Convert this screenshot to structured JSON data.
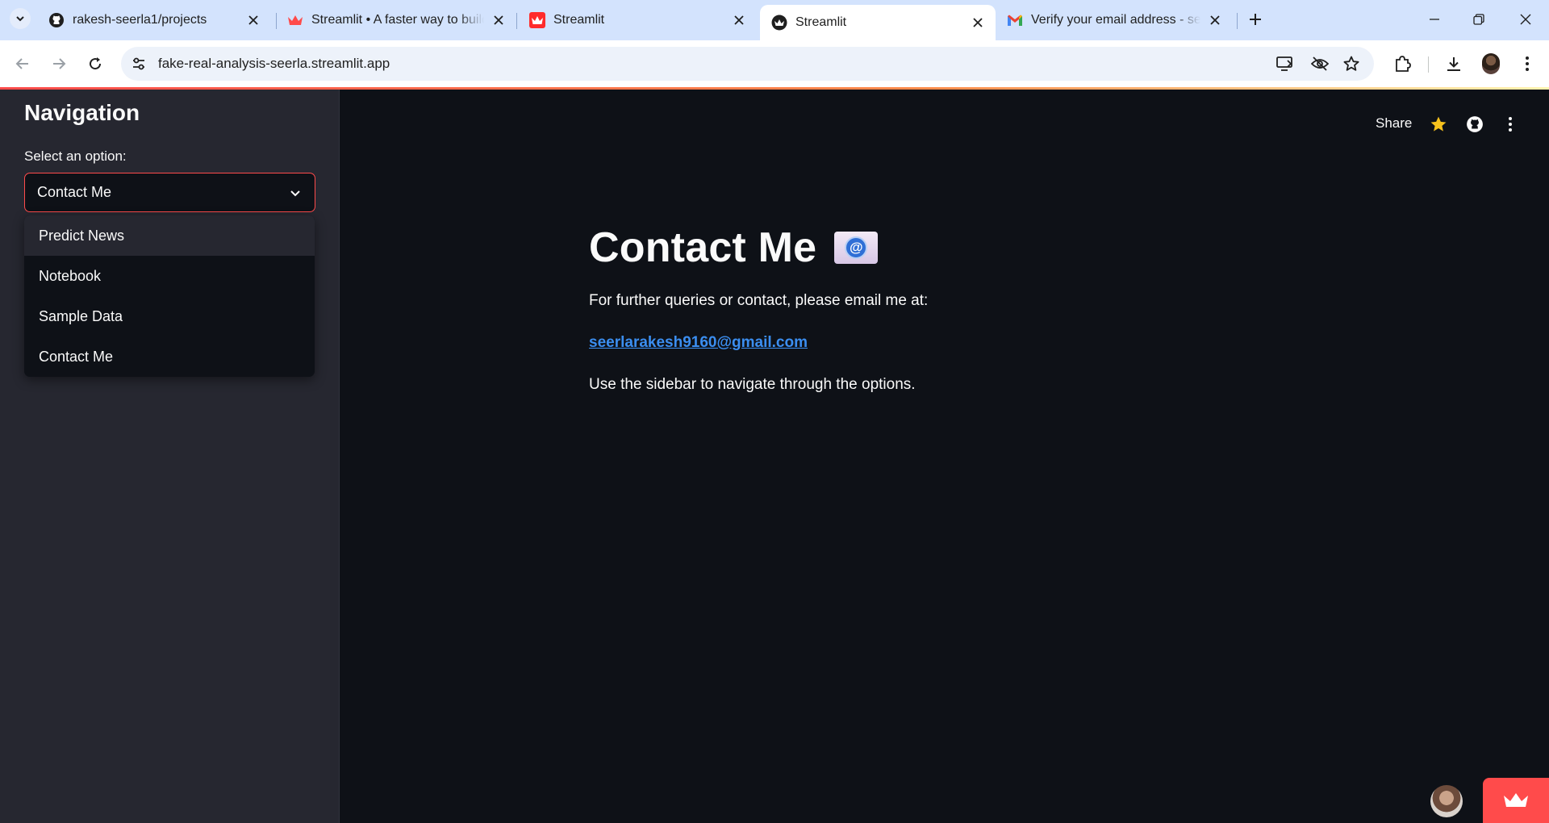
{
  "browser": {
    "tabs": [
      {
        "title": "rakesh-seerla1/projects",
        "icon": "github-icon"
      },
      {
        "title": "Streamlit • A faster way to build",
        "icon": "streamlit-crown-icon"
      },
      {
        "title": "Streamlit",
        "icon": "streamlit-crown-icon"
      },
      {
        "title": "Streamlit",
        "icon": "streamlit-crown-icon",
        "active": true
      },
      {
        "title": "Verify your email address - seer",
        "icon": "gmail-icon"
      }
    ],
    "url": "fake-real-analysis-seerla.streamlit.app"
  },
  "sidebar": {
    "title": "Navigation",
    "select_label": "Select an option:",
    "selected": "Contact Me",
    "options": [
      "Predict News",
      "Notebook",
      "Sample Data",
      "Contact Me"
    ]
  },
  "header": {
    "share_label": "Share"
  },
  "main": {
    "title": "Contact Me",
    "title_emoji_text": "@",
    "intro": "For further queries or contact, please email me at:",
    "email": "seerlarakesh9160@gmail.com",
    "hint": "Use the sidebar to navigate through the options."
  },
  "colors": {
    "accent": "#ff4b4b",
    "link": "#3b8ef0",
    "background": "#0e1117",
    "sidebar": "#262730"
  }
}
